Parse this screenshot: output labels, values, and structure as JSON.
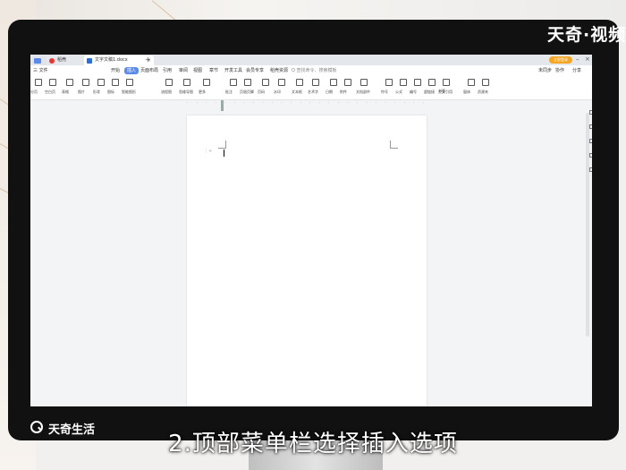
{
  "watermark": {
    "brand": "天奇·视频"
  },
  "browser_tabs": [
    {
      "label": ""
    },
    {
      "label": "稻壳"
    },
    {
      "label": "文字文稿1.docx"
    }
  ],
  "header": {
    "login_label": "立即登录"
  },
  "menu": {
    "items": [
      {
        "label": "三 文件"
      },
      {
        "label": "开始"
      },
      {
        "label": "插入"
      },
      {
        "label": "页面布局"
      },
      {
        "label": "引用"
      },
      {
        "label": "审阅"
      },
      {
        "label": "视图"
      },
      {
        "label": "章节"
      },
      {
        "label": "开发工具"
      },
      {
        "label": "会员专享"
      },
      {
        "label": "稻壳资源"
      },
      {
        "label": "Q 查找命令、搜索模板"
      }
    ],
    "right_actions": [
      {
        "label": "未同步"
      },
      {
        "label": "协作"
      },
      {
        "label": "分享"
      }
    ],
    "active_index": 2
  },
  "toolbar": {
    "items": [
      {
        "label": "分页"
      },
      {
        "label": "空白页"
      },
      {
        "label": "表格"
      },
      {
        "label": "图片"
      },
      {
        "label": "形状"
      },
      {
        "label": "图标"
      },
      {
        "label": "智能图形"
      },
      {
        "label": "流程图"
      },
      {
        "label": "思维导图"
      },
      {
        "label": "更多"
      },
      {
        "label": "批注"
      },
      {
        "label": "页眉页脚"
      },
      {
        "label": "页码"
      },
      {
        "label": "水印"
      },
      {
        "label": "文本框"
      },
      {
        "label": "艺术字"
      },
      {
        "label": "日期"
      },
      {
        "label": "附件"
      },
      {
        "label": "文档部件"
      },
      {
        "label": "符号"
      },
      {
        "label": "公式"
      },
      {
        "label": "编号"
      },
      {
        "label": "超链接"
      },
      {
        "label": "交叉引用"
      },
      {
        "label": "书签"
      },
      {
        "label": "窗体"
      },
      {
        "label": "资源夹"
      }
    ]
  },
  "caption": {
    "brand": "天奇生活",
    "subtitle": "2.顶部菜单栏选择插入选项"
  },
  "colors": {
    "accent": "#5b8be8",
    "login": "#f5a623"
  }
}
